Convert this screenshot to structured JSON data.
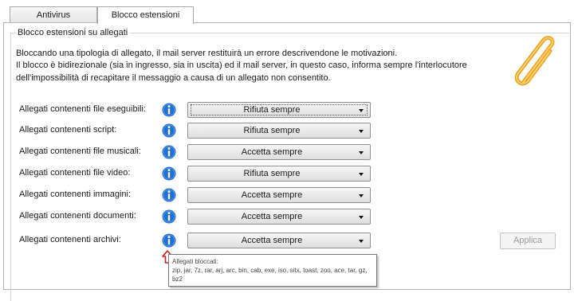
{
  "tabs": [
    {
      "label": "Antivirus",
      "selected": false
    },
    {
      "label": "Blocco estensioni",
      "selected": true
    }
  ],
  "group": {
    "title": "Blocco estensioni su allegati",
    "description": [
      "Bloccando una tipologia di allegato, il mail server restituirà un errore descrivendone le motivazioni.",
      "Il blocco è bidirezionale (sia in ingresso, sia in uscita) ed il mail server, in questo caso, informa sempre l'interlocutore",
      "dell'impossibilità di recapitare il messaggio a causa di un allegato non consentito."
    ]
  },
  "rows": [
    {
      "label": "Allegati contenenti file eseguibili:",
      "value": "Rifiuta sempre",
      "focused": true
    },
    {
      "label": "Allegati contenenti script:",
      "value": "Rifiuta sempre"
    },
    {
      "label": "Allegati contenenti file musicali:",
      "value": "Accetta sempre"
    },
    {
      "label": "Allegati contenenti file video:",
      "value": "Rifiuta sempre"
    },
    {
      "label": "Allegati contenenti immagini:",
      "value": "Accetta sempre"
    },
    {
      "label": "Allegati contenenti documenti:",
      "value": "Accetta sempre"
    },
    {
      "label": "Allegati contenenti archivi:",
      "value": "Accetta sempre"
    }
  ],
  "apply_button": {
    "label": "Applica",
    "enabled": false
  },
  "tooltip": {
    "title": "Allegati bloccati:",
    "line1": "zip, jar, 7z, rar, arj, arc, bin, cab, exe, iso, sitx, toast, zoo, ace, tar, gz,",
    "line2": "bz2"
  },
  "icons": {
    "info": "info-icon",
    "clip": "paperclip-icon",
    "pointer": "red-arrow-up-icon"
  },
  "colors": {
    "info_blue": "#1f6fd6",
    "clip_orange": "#f2a31b",
    "pointer_red": "#d21a1a"
  }
}
